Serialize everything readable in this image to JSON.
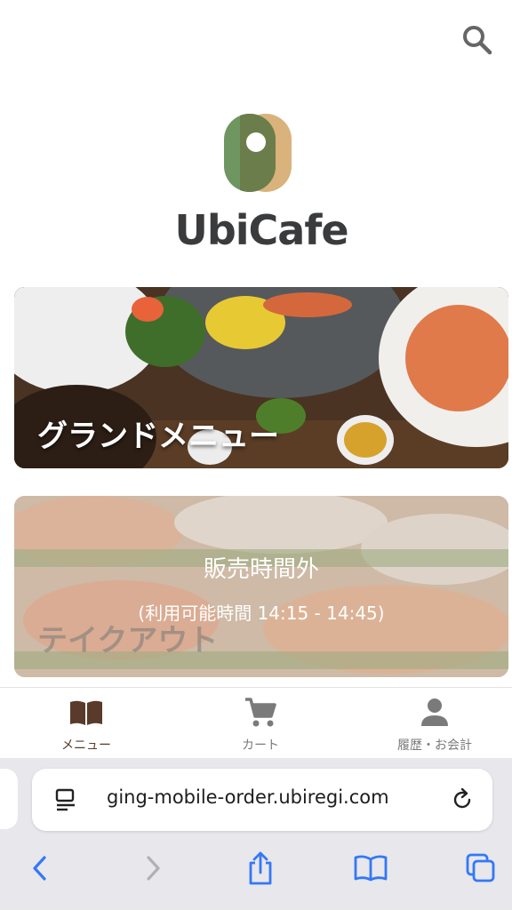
{
  "header": {
    "search_icon": "search-icon"
  },
  "logo": {
    "text": "UbiCafe"
  },
  "cards": [
    {
      "label": "グランドメニュー"
    },
    {
      "label": "テイクアウト",
      "status": "販売時間外",
      "hours": "(利用可能時間 14:15 - 14:45)"
    }
  ],
  "tabbar": {
    "items": [
      {
        "label": "メニュー",
        "icon": "book-icon"
      },
      {
        "label": "カート",
        "icon": "cart-icon"
      },
      {
        "label": "履歴・お会計",
        "icon": "person-icon"
      }
    ]
  },
  "browser": {
    "url": "ging-mobile-order.ubiregi.com"
  },
  "colors": {
    "active_tab": "#5a3a2a",
    "logo_green": "#6f9660",
    "logo_tan": "#d9b27c",
    "ios_blue": "#3478f6"
  }
}
